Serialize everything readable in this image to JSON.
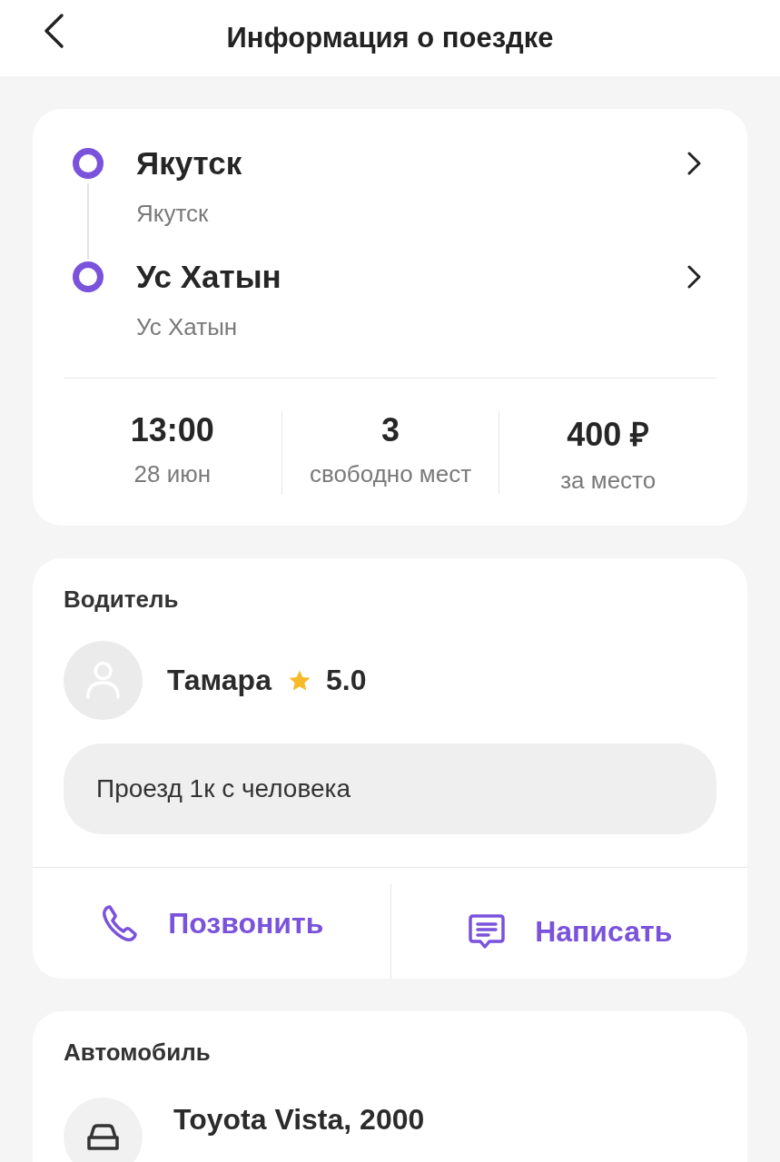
{
  "header": {
    "title": "Информация о поездке"
  },
  "route": {
    "stops": [
      {
        "city": "Якутск",
        "address": "Якутск"
      },
      {
        "city": "Ус Хатын",
        "address": "Ус Хатын"
      }
    ],
    "stats": [
      {
        "value": "13:00",
        "label": "28 июн"
      },
      {
        "value": "3",
        "label": "свободно мест"
      },
      {
        "value": "400 ₽",
        "label": "за место"
      }
    ]
  },
  "driver": {
    "heading": "Водитель",
    "name": "Тамара",
    "rating": "5.0",
    "note": "Проезд 1к с человека",
    "actions": [
      {
        "kind": "call",
        "label": "Позвонить"
      },
      {
        "kind": "message",
        "label": "Написать"
      }
    ]
  },
  "car": {
    "heading": "Автомобиль",
    "model": "Toyota Vista, 2000"
  }
}
